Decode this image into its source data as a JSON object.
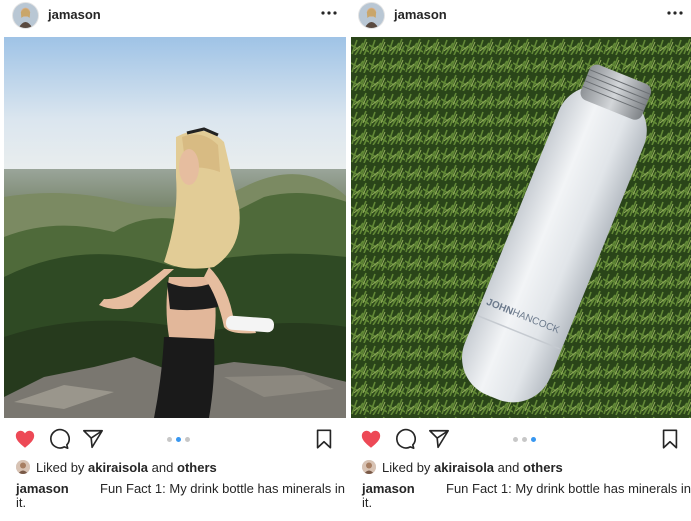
{
  "posts": [
    {
      "username": "jamason",
      "liked_by_prefix": "Liked by",
      "liked_by_user": "akiraisola",
      "liked_by_and": "and",
      "liked_by_others": "others",
      "caption_user": "jamason",
      "caption_line1": "Fun Fact 1: My drink bottle has minerals in",
      "caption_line2": "it.",
      "carousel_active_index": 1,
      "carousel_count": 3
    },
    {
      "username": "jamason",
      "liked_by_prefix": "Liked by",
      "liked_by_user": "akiraisola",
      "liked_by_and": "and",
      "liked_by_others": "others",
      "caption_user": "jamason",
      "caption_line1": "Fun Fact 1: My drink bottle has minerals in",
      "caption_line2": "it.",
      "bottle_brand_bold": "JOHN",
      "bottle_brand_light": "HANCOCK",
      "carousel_active_index": 2,
      "carousel_count": 3
    }
  ],
  "colors": {
    "heart_liked": "#ed4956",
    "carousel_active": "#3897f0",
    "carousel_inactive": "#c7c7c7",
    "text": "#262626"
  },
  "icons": {
    "more": "more-horizontal-icon",
    "like": "heart-filled-icon",
    "comment": "comment-icon",
    "share": "paper-plane-icon",
    "save": "bookmark-icon"
  }
}
